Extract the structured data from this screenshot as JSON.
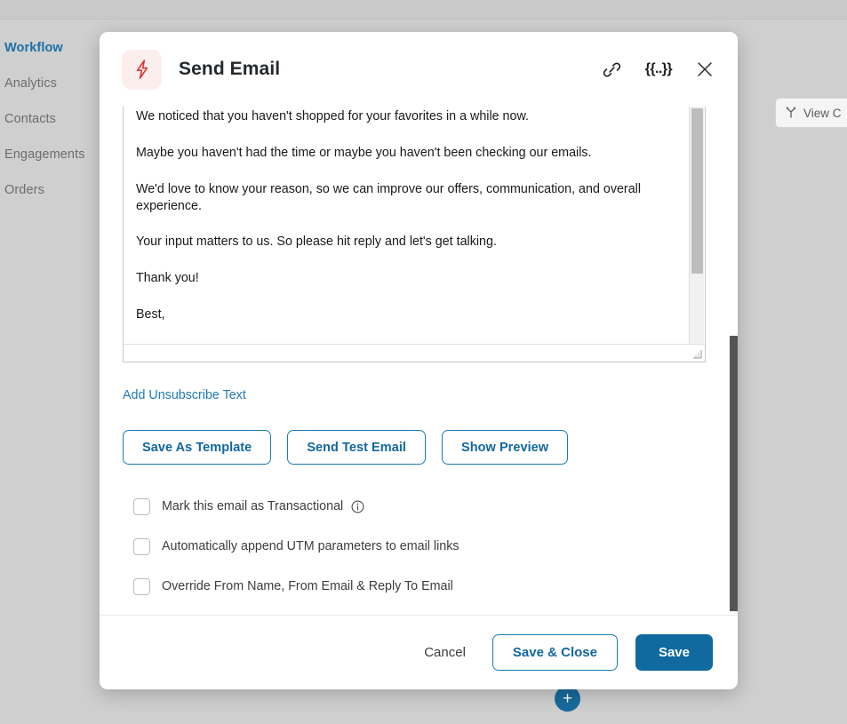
{
  "sidebar": {
    "items": [
      {
        "label": "Workflow",
        "active": true
      },
      {
        "label": "Analytics",
        "active": false
      },
      {
        "label": "Contacts",
        "active": false
      },
      {
        "label": "Engagements",
        "active": false
      },
      {
        "label": "Orders",
        "active": false
      }
    ]
  },
  "canvas": {
    "view_button_label": "View C",
    "add_node_label": "+"
  },
  "modal": {
    "title": "Send Email",
    "icons": {
      "app_icon": "lightning-bolt-icon",
      "link": "link-icon",
      "template_variable": "{{..}}",
      "close": "close-icon"
    },
    "editor": {
      "paragraphs": [
        "We noticed that you haven't shopped for your favorites in a while now.",
        "Maybe you haven't had the time or maybe you haven't been checking our emails.",
        "We'd love to know your reason, so we can improve our offers, communication, and overall experience.",
        "Your input matters to us. So please hit reply and let's get talking.",
        "Thank you!",
        "Best,"
      ]
    },
    "unsubscribe_link": "Add Unsubscribe Text",
    "actions": [
      "Save As Template",
      "Send Test Email",
      "Show Preview"
    ],
    "checkboxes": [
      {
        "label": "Mark this email as Transactional",
        "checked": false,
        "has_info": true
      },
      {
        "label": "Automatically append UTM parameters to email links",
        "checked": false,
        "has_info": false
      },
      {
        "label": "Override From Name, From Email & Reply To Email",
        "checked": false,
        "has_info": false,
        "highlighted": true
      }
    ],
    "footer": {
      "cancel": "Cancel",
      "save_close": "Save & Close",
      "save": "Save"
    }
  },
  "annotation": {
    "highlight_color": "#ee0000",
    "arrow_direction": "left",
    "target": "Override From Name, From Email & Reply To Email"
  },
  "colors": {
    "accent_blue": "#10699f",
    "link_blue": "#1f7cb6",
    "bolt_red": "#d93a33",
    "bolt_bg": "#fdeeee",
    "overlay_gray": "#cfcfcf"
  }
}
